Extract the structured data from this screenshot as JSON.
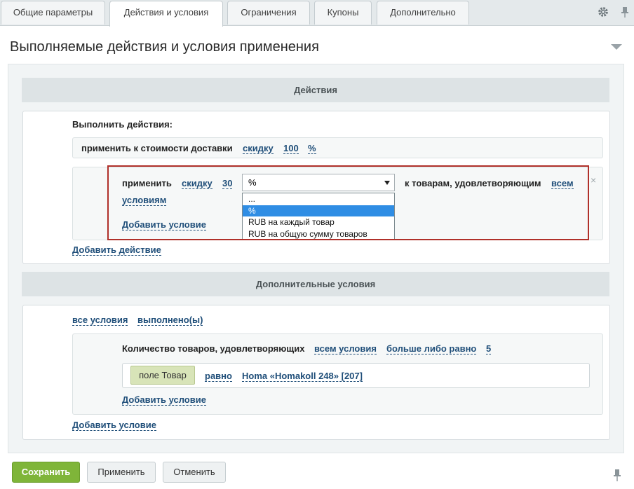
{
  "tabs": [
    {
      "label": "Общие параметры"
    },
    {
      "label": "Действия и условия"
    },
    {
      "label": "Ограничения"
    },
    {
      "label": "Купоны"
    },
    {
      "label": "Дополнительно"
    }
  ],
  "section_title": "Выполняемые действия и условия применения",
  "actions": {
    "header": "Действия",
    "execute_label": "Выполнить действия:",
    "row1": {
      "text": "применить к стоимости доставки",
      "type": "скидку",
      "value": "100",
      "unit": "%"
    },
    "row2": {
      "text": "применить",
      "type": "скидку",
      "value": "30",
      "unit_selected": "%",
      "goods_text": "к товарам, удовлетворяющим",
      "all_1": "всем",
      "all_2": "условиям",
      "add_condition": "Добавить условие",
      "options": [
        "...",
        "%",
        "RUB на каждый товар",
        "RUB на общую сумму товаров"
      ],
      "close": "×"
    },
    "add_action": "Добавить действие"
  },
  "extra": {
    "header": "Дополнительные условия",
    "all_conditions": "все условия",
    "fulfilled": "выполнено(ы)",
    "qty": {
      "text": "Количество товаров, удовлетворяющих",
      "all": "всем условия",
      "cmp": "больше либо равно",
      "value": "5"
    },
    "field": {
      "label": "поле Товар",
      "eq": "равно",
      "value": "Homa «Homakoll 248» [207]"
    },
    "add_condition_inner": "Добавить условие",
    "add_condition_outer": "Добавить условие"
  },
  "footer": {
    "save": "Сохранить",
    "apply": "Применить",
    "cancel": "Отменить"
  },
  "colors": {
    "accent_green": "#7fb539",
    "link_blue": "#1f4e79",
    "dropdown_highlight": "#2f8de4",
    "highlight_frame": "#b0302a"
  }
}
